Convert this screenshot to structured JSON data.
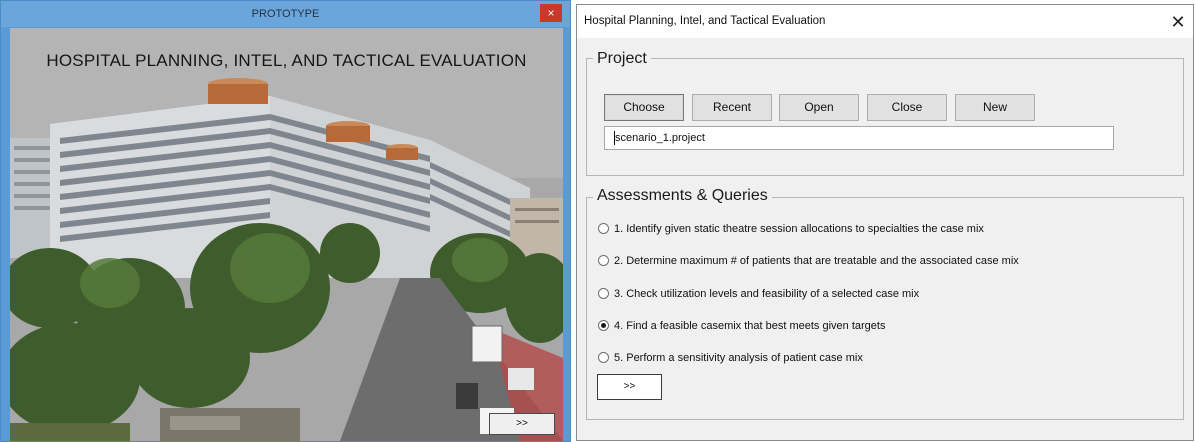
{
  "left_window": {
    "title": "PROTOTYPE",
    "close_label": "×",
    "heading": "HOSPITAL PLANNING, INTEL, AND TACTICAL EVALUATION",
    "next_label": ">>",
    "colors": {
      "title_bar": "#6aa6dc",
      "close": "#c9382b"
    }
  },
  "right_window": {
    "title": "Hospital Planning, Intel, and Tactical Evaluation",
    "close_label": "✕",
    "project": {
      "legend": "Project",
      "buttons": [
        "Choose",
        "Recent",
        "Open",
        "Close",
        "New"
      ],
      "file_value": "scenario_1.project"
    },
    "assessments": {
      "legend": "Assessments & Queries",
      "options": [
        {
          "label": "1. Identify given static theatre session allocations to specialties the case mix",
          "checked": false
        },
        {
          "label": "2. Determine maximum # of patients that are treatable and the associated case mix",
          "checked": false
        },
        {
          "label": "3. Check utilization levels and feasibility of a selected case mix",
          "checked": false
        },
        {
          "label": "4. Find a feasible casemix that best meets given targets",
          "checked": true
        },
        {
          "label": "5. Perform a sensitivity analysis of patient case mix",
          "checked": false
        }
      ],
      "go_label": ">>"
    }
  }
}
